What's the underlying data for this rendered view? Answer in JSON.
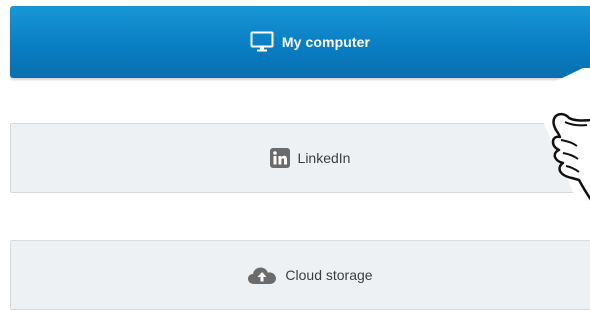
{
  "sources": [
    {
      "label": "My computer",
      "icon": "monitor-icon",
      "active": true
    },
    {
      "label": "LinkedIn",
      "icon": "linkedin-icon",
      "active": false
    },
    {
      "label": "Cloud storage",
      "icon": "cloud-upload-icon",
      "active": false
    }
  ],
  "colors": {
    "primary": "#0a7ec3",
    "secondary_bg": "#eef1f3",
    "secondary_border": "#d6dbdf",
    "icon_gray": "#6b6b6b"
  },
  "decoration": {
    "icon": "pointing-hand-icon"
  }
}
